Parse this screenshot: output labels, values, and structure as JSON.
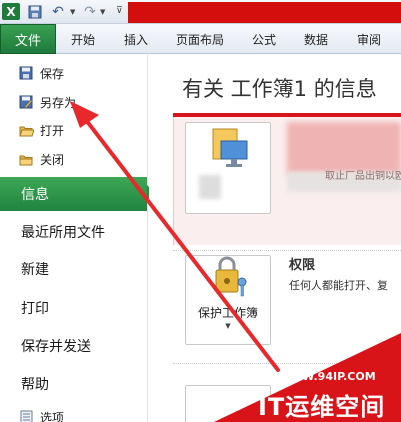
{
  "quick_access": {
    "app_icon": "X",
    "save_icon": "save-icon",
    "undo_icon": "undo-icon",
    "redo_icon": "redo-icon"
  },
  "ribbon": {
    "file_tab": "文件",
    "tabs": [
      "开始",
      "插入",
      "页面布局",
      "公式",
      "数据",
      "审阅"
    ]
  },
  "nav": {
    "small_items": [
      {
        "label": "保存",
        "icon": "save-icon"
      },
      {
        "label": "另存为",
        "icon": "save-as-icon"
      },
      {
        "label": "打开",
        "icon": "open-folder-icon"
      },
      {
        "label": "关闭",
        "icon": "close-folder-icon"
      }
    ],
    "large_items": [
      "信息",
      "最近所用文件",
      "新建",
      "打印",
      "保存并发送",
      "帮助"
    ],
    "bottom_item": {
      "label": "选项",
      "icon": "options-icon"
    },
    "selected": "信息"
  },
  "main": {
    "title": "有关 工作簿1 的信息",
    "info_text_fragment": "取止厂品出铜以欧版",
    "protect_button": "保护工作簿",
    "permissions_title": "权限",
    "permissions_desc": "任何人都能打开、复"
  },
  "watermark": {
    "url": "WWW.94IP.COM",
    "text": "IT运维空间"
  },
  "colors": {
    "file_tab_green": "#1f7a3c",
    "selected_nav_green": "#27903f",
    "accent_red": "#d40d0d",
    "arrow_red": "#e8282b"
  }
}
